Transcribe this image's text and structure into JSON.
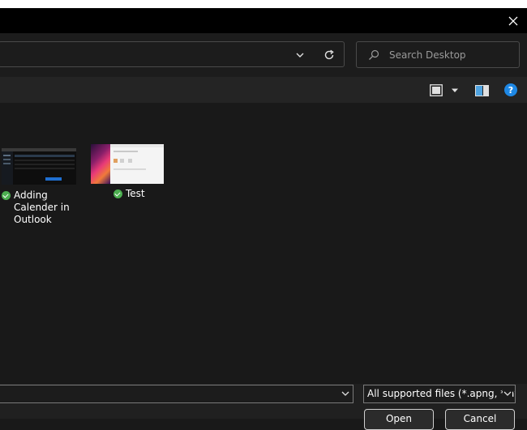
{
  "search": {
    "placeholder": "Search Desktop"
  },
  "files": [
    {
      "name": "Adding Calender in Outlook"
    },
    {
      "name": "Test"
    }
  ],
  "bottom": {
    "filter_label": "All supported files (*.apng, *.av",
    "open_label": "Open",
    "cancel_label": "Cancel"
  },
  "colors": {
    "status_synced": "#4caf50",
    "help": "#1e88e5"
  }
}
